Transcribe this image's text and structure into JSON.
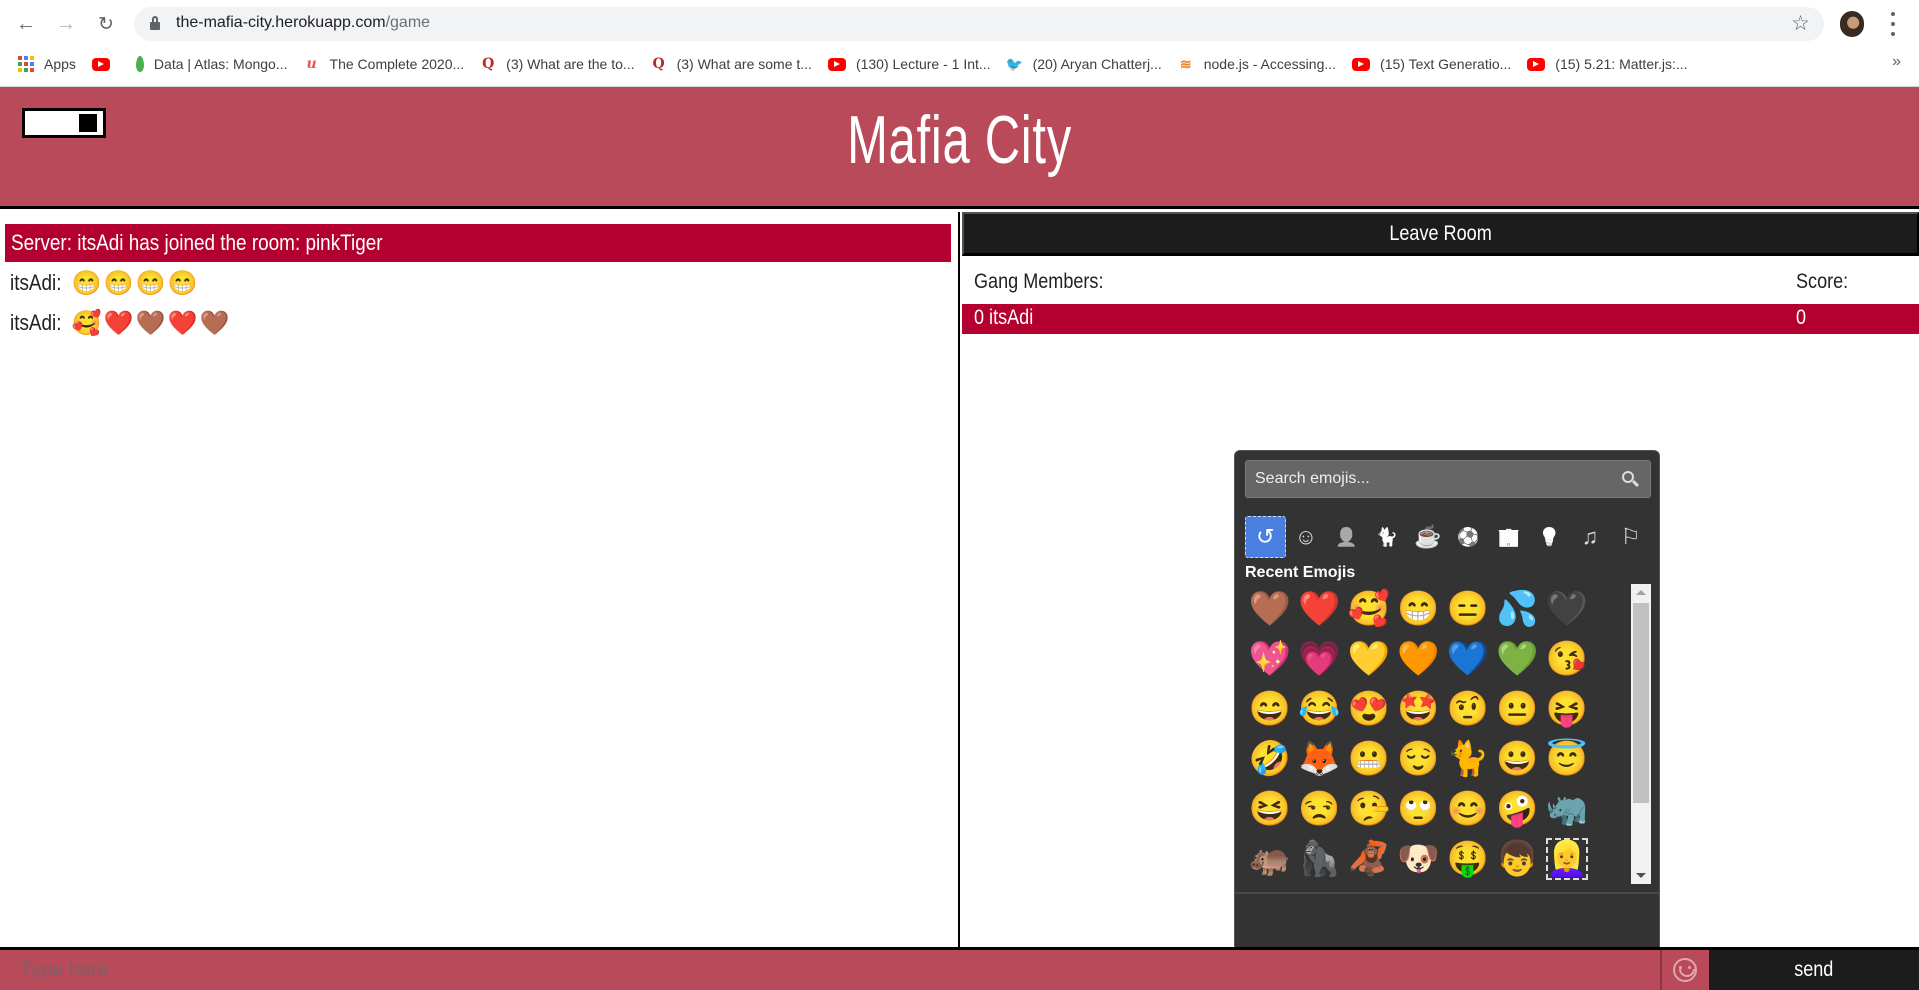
{
  "browser": {
    "url_host": "the-mafia-city.herokuapp.com",
    "url_path": "/game",
    "bookmarks": [
      {
        "label": "Apps",
        "icon": "apps-grid-icon"
      },
      {
        "label": "",
        "icon": "youtube-icon"
      },
      {
        "label": "Data | Atlas: Mongo...",
        "icon": "mongodb-leaf-icon"
      },
      {
        "label": "The Complete 2020...",
        "icon": "udemy-icon"
      },
      {
        "label": "(3) What are the to...",
        "icon": "quora-icon"
      },
      {
        "label": "(3) What are some t...",
        "icon": "quora-icon"
      },
      {
        "label": "(130) Lecture - 1 Int...",
        "icon": "youtube-icon"
      },
      {
        "label": "(20) Aryan Chatterj...",
        "icon": "twitter-icon"
      },
      {
        "label": "node.js - Accessing...",
        "icon": "stackoverflow-icon"
      },
      {
        "label": "(15) Text Generatio...",
        "icon": "youtube-icon"
      },
      {
        "label": "(15) 5.21: Matter.js:...",
        "icon": "youtube-icon"
      }
    ],
    "more_label": "»"
  },
  "app": {
    "title": "Mafia City",
    "colors": {
      "header": "#b84a59",
      "accent": "#b40030",
      "dark": "#1c1c1c"
    }
  },
  "chat": {
    "server_message": "Server: itsAdi has joined the room: pinkTiger",
    "messages": [
      {
        "user": "itsAdi:",
        "text": "😁😁😁😁"
      },
      {
        "user": "itsAdi:",
        "text": "🥰❤️🤎❤️🤎"
      }
    ]
  },
  "sidebar": {
    "leave_label": "Leave Room",
    "members_header": "Gang Members:",
    "score_header": "Score:",
    "members": [
      {
        "name": "0 itsAdi",
        "score": "0"
      }
    ]
  },
  "emoji_picker": {
    "search_placeholder": "Search emojis...",
    "categories": [
      {
        "name": "recent",
        "glyph": "↺",
        "active": true
      },
      {
        "name": "smileys",
        "glyph": "☺"
      },
      {
        "name": "people",
        "glyph": "👤"
      },
      {
        "name": "animals",
        "glyph": "🐈"
      },
      {
        "name": "food",
        "glyph": "☕"
      },
      {
        "name": "activities",
        "glyph": "⚽"
      },
      {
        "name": "travel",
        "glyph": "🏢"
      },
      {
        "name": "objects",
        "glyph": "💡"
      },
      {
        "name": "symbols",
        "glyph": "♫"
      },
      {
        "name": "flags",
        "glyph": "⚐"
      }
    ],
    "section_title": "Recent Emojis",
    "recent": [
      "🤎",
      "❤️",
      "🥰",
      "😁",
      "😑",
      "💦",
      "🖤",
      "💖",
      "💗",
      "💛",
      "🧡",
      "💙",
      "💚",
      "😘",
      "😄",
      "😂",
      "😍",
      "🤩",
      "🤨",
      "😐",
      "😝",
      "🤣",
      "🦊",
      "😬",
      "😌",
      "🐈",
      "😀",
      "😇",
      "😆",
      "😒",
      "🤥",
      "🙄",
      "😊",
      "🤪",
      "🦏",
      "🦛",
      "🦍",
      "🦧",
      "🐶",
      "🤑",
      "👦",
      "👱‍♀️"
    ],
    "focused_index": 41
  },
  "composer": {
    "placeholder": "Type here",
    "value": "",
    "send_label": "send"
  }
}
